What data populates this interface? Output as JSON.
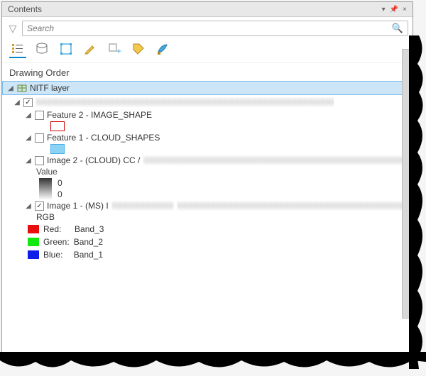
{
  "panel": {
    "title": "Contents"
  },
  "search": {
    "placeholder": "Search"
  },
  "section": {
    "title": "Drawing Order"
  },
  "root": {
    "label": "NITF layer"
  },
  "dataset": {
    "redacted_name": "XXXXXXXXXXXXXXXXXXXXXXXXXXXXXXXXXXXXXXXXXXXX"
  },
  "feature2": {
    "label": "Feature 2 - IMAGE_SHAPE"
  },
  "feature1": {
    "label": "Feature 1 - CLOUD_SHAPES"
  },
  "image2": {
    "label": "Image 2 - (CLOUD) CC / ",
    "value_label": "Value",
    "top_value": "0",
    "bottom_value": "0"
  },
  "image1": {
    "label": "Image 1 - (MS) I",
    "rgb_label": "RGB",
    "red": {
      "label": "Red:",
      "band": "Band_3"
    },
    "green": {
      "label": "Green:",
      "band": "Band_2"
    },
    "blue": {
      "label": "Blue:",
      "band": "Band_1"
    }
  },
  "redacted": {
    "short": "XXXXXXXXXXX",
    "long": "XXXXXXXXXXXXXXXXXXXXXXXXXXXXXXXXXXXXXXXXXXXXXXXXXXXXXXXXXXXXXXXXXXXX"
  }
}
